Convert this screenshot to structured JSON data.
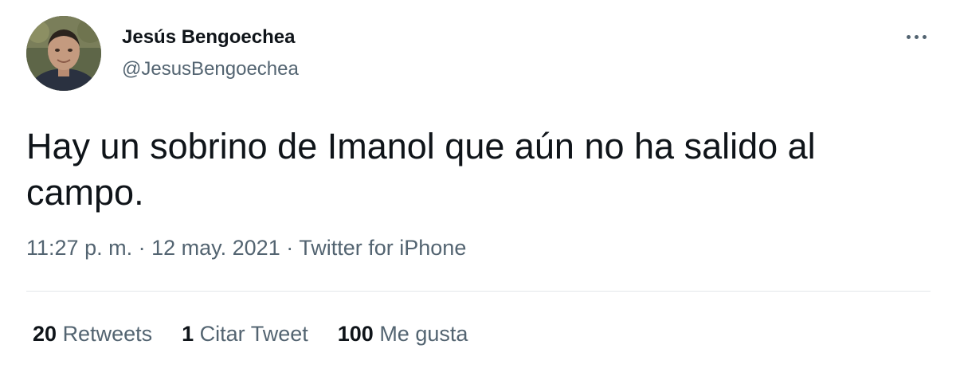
{
  "author": {
    "name": "Jesús Bengoechea",
    "handle": "@JesusBengoechea"
  },
  "icons": {
    "more": "more-horizontal-icon",
    "avatar": "profile-photo"
  },
  "tweet": {
    "text": "Hay un sobrino de Imanol que aún no ha salido al campo.",
    "time": "11:27 p. m.",
    "separator": "·",
    "date": "12 may. 2021",
    "source": "Twitter for iPhone"
  },
  "stats": [
    {
      "count": "20",
      "label": "Retweets"
    },
    {
      "count": "1",
      "label": "Citar Tweet"
    },
    {
      "count": "100",
      "label": "Me gusta"
    }
  ],
  "colors": {
    "text": "#0f1419",
    "secondary": "#536471",
    "divider": "#e3e7ea",
    "background": "#ffffff"
  }
}
